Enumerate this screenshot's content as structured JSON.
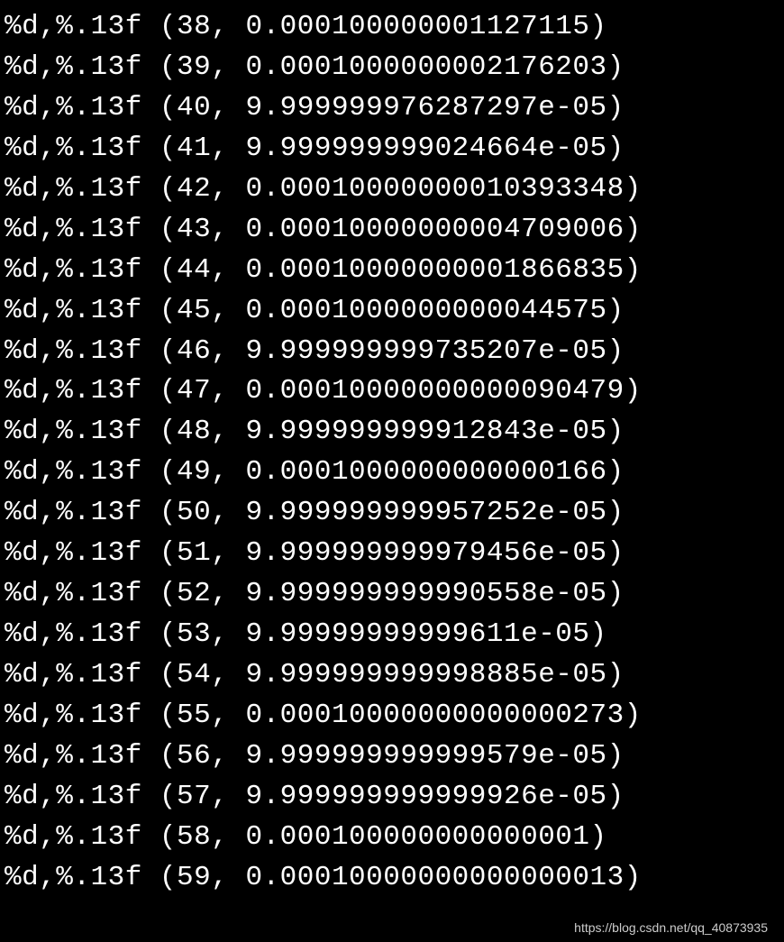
{
  "format_string": "%d,%.13f",
  "lines": [
    {
      "index": 38,
      "value": "0.000100000001127115"
    },
    {
      "index": 39,
      "value": "0.0001000000002176203"
    },
    {
      "index": 40,
      "value": "9.999999976287297e-05"
    },
    {
      "index": 41,
      "value": "9.999999999024664e-05"
    },
    {
      "index": 42,
      "value": "0.00010000000010393348"
    },
    {
      "index": 43,
      "value": "0.00010000000004709006"
    },
    {
      "index": 44,
      "value": "0.00010000000001866835"
    },
    {
      "index": 45,
      "value": "0.0001000000000044575"
    },
    {
      "index": 46,
      "value": "9.999999999735207e-05"
    },
    {
      "index": 47,
      "value": "0.00010000000000090479"
    },
    {
      "index": 48,
      "value": "9.999999999912843e-05"
    },
    {
      "index": 49,
      "value": "0.0001000000000000166"
    },
    {
      "index": 50,
      "value": "9.999999999957252e-05"
    },
    {
      "index": 51,
      "value": "9.999999999979456e-05"
    },
    {
      "index": 52,
      "value": "9.999999999990558e-05"
    },
    {
      "index": 53,
      "value": "9.99999999999611e-05"
    },
    {
      "index": 54,
      "value": "9.999999999998885e-05"
    },
    {
      "index": 55,
      "value": "0.00010000000000000273"
    },
    {
      "index": 56,
      "value": "9.999999999999579e-05"
    },
    {
      "index": 57,
      "value": "9.999999999999926e-05"
    },
    {
      "index": 58,
      "value": "0.000100000000000001"
    },
    {
      "index": 59,
      "value": "0.00010000000000000013"
    }
  ],
  "watermark": "https://blog.csdn.net/qq_40873935"
}
